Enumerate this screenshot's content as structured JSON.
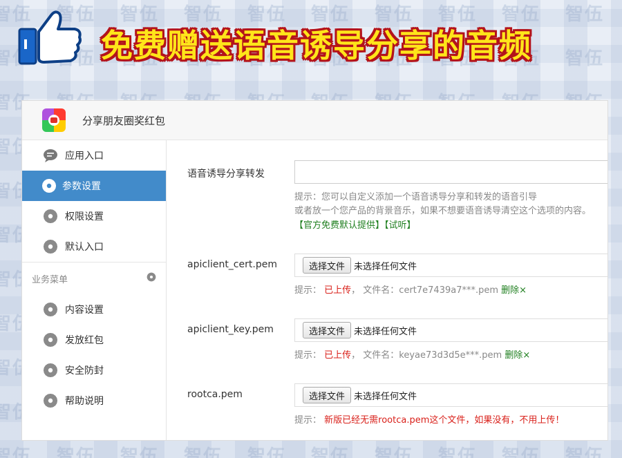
{
  "banner": {
    "title": "免费赠送语音诱导分享的音频"
  },
  "watermark": {
    "text": "智伍应用"
  },
  "app": {
    "title": "分享朋友圈奖红包"
  },
  "sidebar": {
    "items": [
      {
        "label": "应用入口",
        "icon": "chat-icon",
        "active": false
      },
      {
        "label": "参数设置",
        "icon": "gear-icon",
        "active": true
      },
      {
        "label": "权限设置",
        "icon": "gear-icon",
        "active": false
      },
      {
        "label": "默认入口",
        "icon": "gear-icon",
        "active": false
      }
    ],
    "section_label": "业务菜单",
    "sub_items": [
      {
        "label": "内容设置",
        "icon": "gear-icon"
      },
      {
        "label": "发放红包",
        "icon": "gear-icon"
      },
      {
        "label": "安全防封",
        "icon": "gear-icon"
      },
      {
        "label": "帮助说明",
        "icon": "gear-icon"
      }
    ]
  },
  "form": {
    "voice": {
      "label": "语音诱导分享转发",
      "value": "",
      "help_line1": "提示：您可以自定义添加一个语音诱导分享和转发的语音引导",
      "help_line2": "或者放一个您产品的背景音乐，如果不想要语音诱导清空这个选项的内容。",
      "link1": "【官方免费默认提供】",
      "link2": "【试听】"
    },
    "cert": {
      "label": "apiclient_cert.pem",
      "button": "选择文件",
      "status": "未选择任何文件",
      "hint_prefix": "提示：",
      "uploaded": "已上传",
      "filename_text": "，  文件名：cert7e7439a7***.pem",
      "delete": "删除×"
    },
    "key": {
      "label": "apiclient_key.pem",
      "button": "选择文件",
      "status": "未选择任何文件",
      "hint_prefix": "提示：",
      "uploaded": "已上传",
      "filename_text": "，  文件名：keyae73d3d5e***.pem",
      "delete": "删除×"
    },
    "rootca": {
      "label": "rootca.pem",
      "button": "选择文件",
      "status": "未选择任何文件",
      "hint_prefix": "提示：",
      "hint_red": "新版已经无需rootca.pem这个文件，如果没有，不用上传！"
    }
  },
  "colors": {
    "accent": "#428bca",
    "banner_text": "#ffe51a",
    "banner_outline": "#b3131b",
    "thumb_blue": "#1a66c8",
    "danger": "#d9201a",
    "success": "#1f7f1f"
  }
}
